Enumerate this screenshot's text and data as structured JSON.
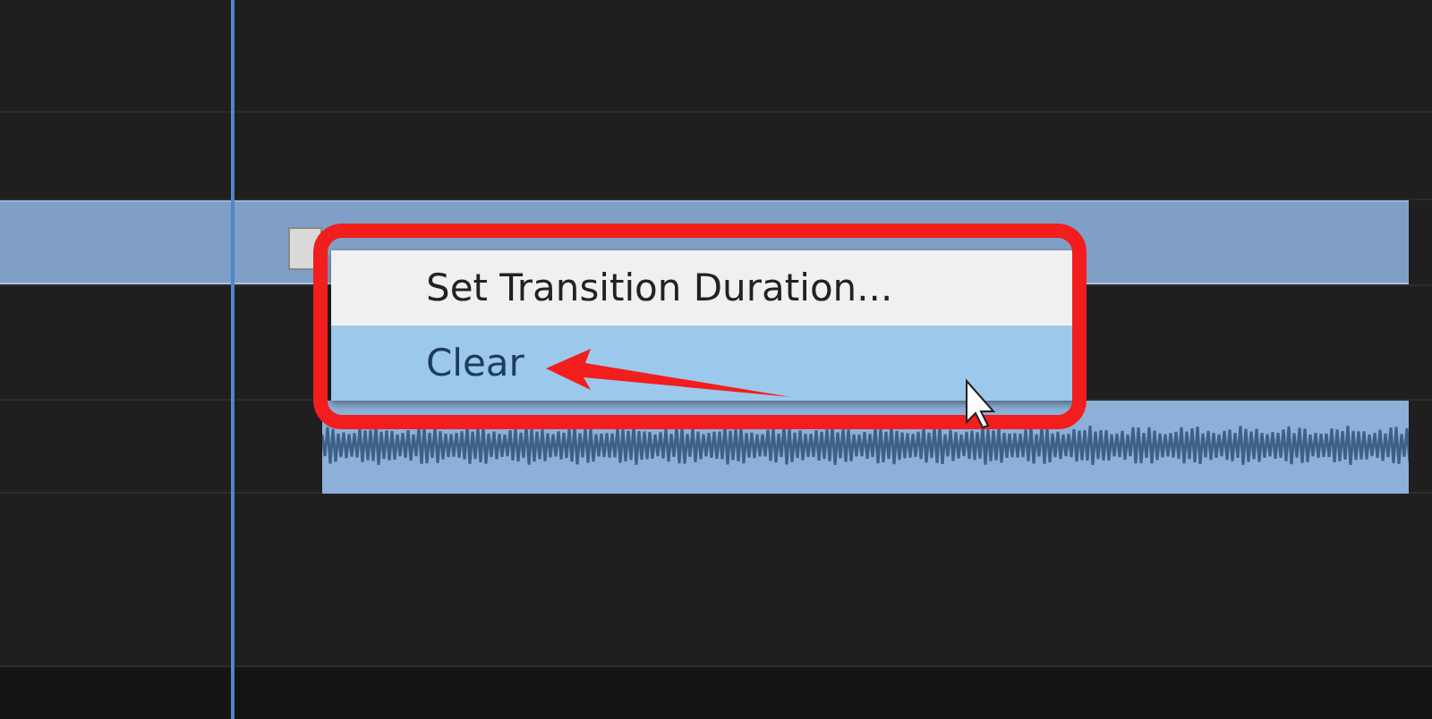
{
  "context_menu": {
    "items": [
      {
        "label": "Set Transition Duration...",
        "selected": false
      },
      {
        "label": "Clear",
        "selected": true
      }
    ]
  }
}
